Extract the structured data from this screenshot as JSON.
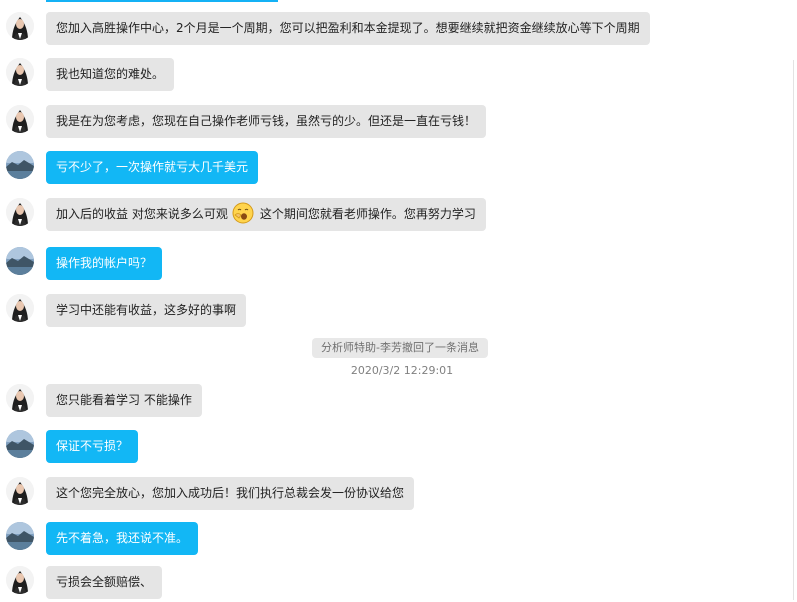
{
  "accent_color": "#12b7f5",
  "icons": {
    "agent_avatar": "female-portrait-avatar",
    "user_avatar": "landscape-avatar",
    "emoji": "yawning-face-emoji"
  },
  "messages": [
    {
      "sender": "agent",
      "text": "您加入高胜操作中心，2个月是一个周期，您可以把盈利和本金提现了。想要继续就把资金继续放心等下个周期"
    },
    {
      "sender": "agent",
      "text": "我也知道您的难处。"
    },
    {
      "sender": "agent",
      "text": "我是在为您考虑，您现在自己操作老师亏钱，虽然亏的少。但还是一直在亏钱！"
    },
    {
      "sender": "user",
      "text": "亏不少了，一次操作就亏大几千美元"
    },
    {
      "sender": "agent",
      "text_before": "加入后的收益 对您来说多么可观",
      "text_after": "这个期间您就看老师操作。您再努力学习"
    },
    {
      "sender": "user",
      "text": "操作我的帐户吗？"
    },
    {
      "sender": "agent",
      "text": "学习中还能有收益，这多好的事啊"
    },
    {
      "sender": "agent",
      "text": "您只能看着学习 不能操作"
    },
    {
      "sender": "user",
      "text": "保证不亏损？"
    },
    {
      "sender": "agent",
      "text": "这个您完全放心，您加入成功后！我们执行总裁会发一份协议给您"
    },
    {
      "sender": "user",
      "text": "先不着急，我还说不准。"
    },
    {
      "sender": "agent",
      "text": "亏损会全额赔偿、"
    }
  ],
  "system_notice": "分析师特助-李芳撤回了一条消息",
  "timestamp": "2020/3/2 12:29:01"
}
